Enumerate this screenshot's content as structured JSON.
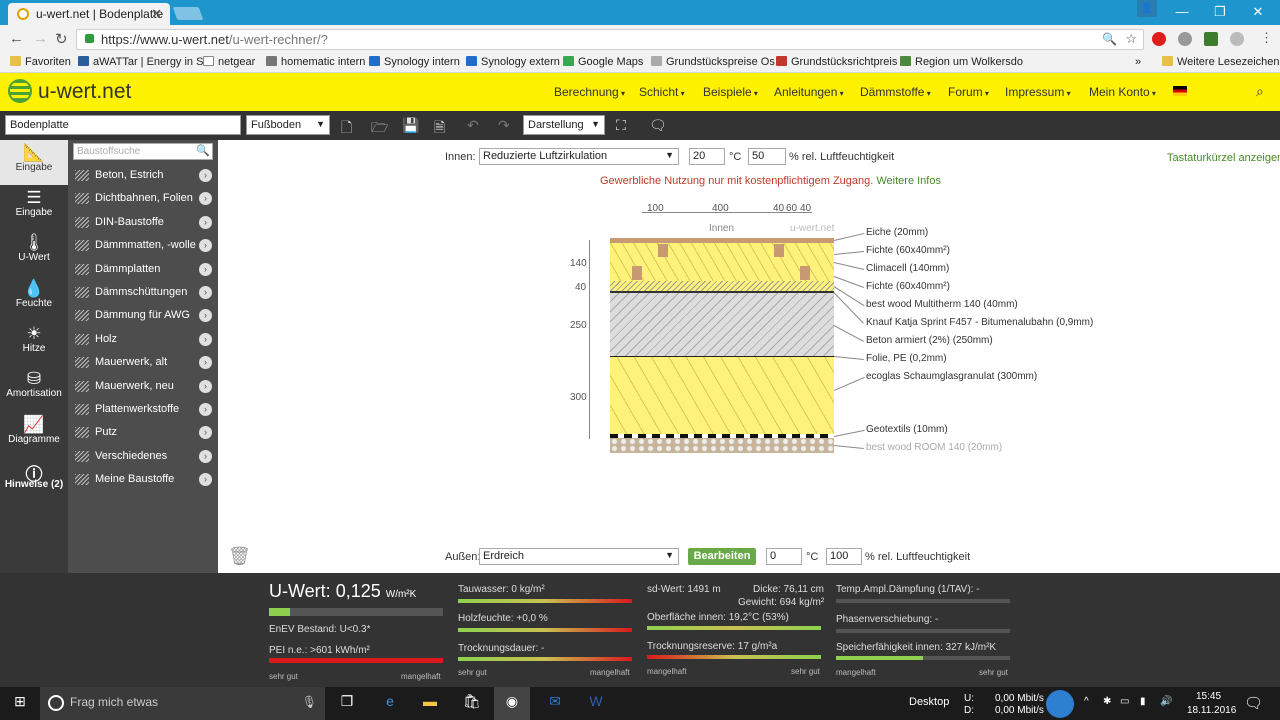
{
  "browser": {
    "tab_title": "u-wert.net | Bodenplatte",
    "url_host": "https://www.u-wert.net",
    "url_path": "/u-wert-rechner/?",
    "bookmarks": [
      "Favoriten",
      "aWATTar | Energy in S",
      "netgear",
      "homematic intern",
      "Synology intern",
      "Synology extern",
      "Google Maps",
      "Grundstückspreise Os",
      "Grundstücksrichtpreis",
      "Region um Wolkersdo",
      "»",
      "Weitere Lesezeichen"
    ]
  },
  "site": {
    "logo": "u-wert.net",
    "nav": [
      "Berechnung",
      "Schicht",
      "Beispiele",
      "Anleitungen",
      "Dämmstoffe",
      "Forum",
      "Impressum",
      "Mein Konto"
    ]
  },
  "toolbar": {
    "name_value": "Bodenplatte",
    "type_value": "Fußboden",
    "view_value": "Darstellung"
  },
  "sidebar": [
    {
      "label": "Eingabe",
      "icon": "ruler-icon"
    },
    {
      "label": "Eingabe",
      "icon": "layers-icon"
    },
    {
      "label": "U-Wert",
      "icon": "thermometer-icon"
    },
    {
      "label": "Feuchte",
      "icon": "drop-icon"
    },
    {
      "label": "Hitze",
      "icon": "sun-icon"
    },
    {
      "label": "Amortisation",
      "icon": "coins-icon"
    },
    {
      "label": "Diagramme",
      "icon": "chart-icon"
    },
    {
      "label": "Hinweise (2)",
      "icon": "warning-icon"
    }
  ],
  "materials": {
    "search_placeholder": "Baustoffsuche",
    "items": [
      "Beton, Estrich",
      "Dichtbahnen, Folien",
      "DIN-Baustoffe",
      "Dämmmatten, -wolle",
      "Dämmplatten",
      "Dämmschüttungen",
      "Dämmung für AWG",
      "Holz",
      "Mauerwerk, alt",
      "Mauerwerk, neu",
      "Plattenwerkstoffe",
      "Putz",
      "Verschiedenes",
      "Meine Baustoffe"
    ]
  },
  "main": {
    "innen_label": "Innen:",
    "innen_select": "Reduzierte Luftzirkulation",
    "innen_temp": "20",
    "innen_temp_unit": "°C",
    "innen_hum": "50",
    "innen_hum_unit": "% rel. Luftfeuchtigkeit",
    "shortcuts": "Tastaturkürzel anzeigen",
    "notice": "Gewerbliche Nutzung nur mit kostenpflichtigem Zugang.",
    "notice_link": "Weitere Infos",
    "aussen_label": "Außen:",
    "aussen_select": "Erdreich",
    "edit_button": "Bearbeiten",
    "aussen_temp": "0",
    "aussen_temp_unit": "°C",
    "aussen_hum": "100",
    "aussen_hum_unit": "% rel. Luftfeuchtigkeit"
  },
  "diagram": {
    "top_dims": [
      "100",
      "400",
      "40",
      "60",
      "40"
    ],
    "innen": "Innen",
    "watermark": "u-wert.net",
    "side_dims": [
      "140",
      "40",
      "250",
      "300"
    ],
    "layers": [
      "Eiche (20mm)",
      "Fichte (60x40mm²)",
      "Climacell (140mm)",
      "Fichte (60x40mm²)",
      "best wood Multitherm 140 (40mm)",
      "Knauf Katja Sprint F457 - Bitumenalubahn (0,9mm)",
      "Beton armiert (2%) (250mm)",
      "Folie, PE (0,2mm)",
      "ecoglas Schaumglasgranulat (300mm)",
      "Geotextils (10mm)",
      "best wood ROOM 140 (20mm)"
    ]
  },
  "results": {
    "uwert_label": "U-Wert:",
    "uwert_value": "0,125",
    "uwert_unit": "W/m²K",
    "enev": "EnEV Bestand: U<0.3*",
    "pei": "PEI n.e.: >601 kWh/m²",
    "tauwasser": "Tauwasser: 0 kg/m²",
    "holzfeuchte": "Holzfeuchte: +0,0 %",
    "trocknungsdauer": "Trocknungsdauer: -",
    "sd": "sd-Wert: 1491 m",
    "dicke": "Dicke: 76,11 cm",
    "gewicht": "Gewicht: 694 kg/m²",
    "oberflaeche": "Oberfläche innen: 19,2°C (53%)",
    "trocknungsreserve": "Trocknungsreserve: 17 g/m²a",
    "temp_ampl": "Temp.Ampl.Dämpfung (1/TAV): -",
    "phasen": "Phasenverschiebung: -",
    "speicher": "Speicherfähigkeit innen: 327 kJ/m²K",
    "scale_good": "sehr gut",
    "scale_bad": "mangelhaft",
    "uwert_level": 0.12,
    "pei_level": 1.0,
    "speicher_level": 0.5
  },
  "taskbar": {
    "search": "Frag mich etwas",
    "desktop": "Desktop",
    "net_u": "U:",
    "net_d": "D:",
    "net_u_val": "0,00 Mbit/s",
    "net_d_val": "0,00 Mbit/s",
    "time": "15:45",
    "date": "18.11.2016"
  }
}
